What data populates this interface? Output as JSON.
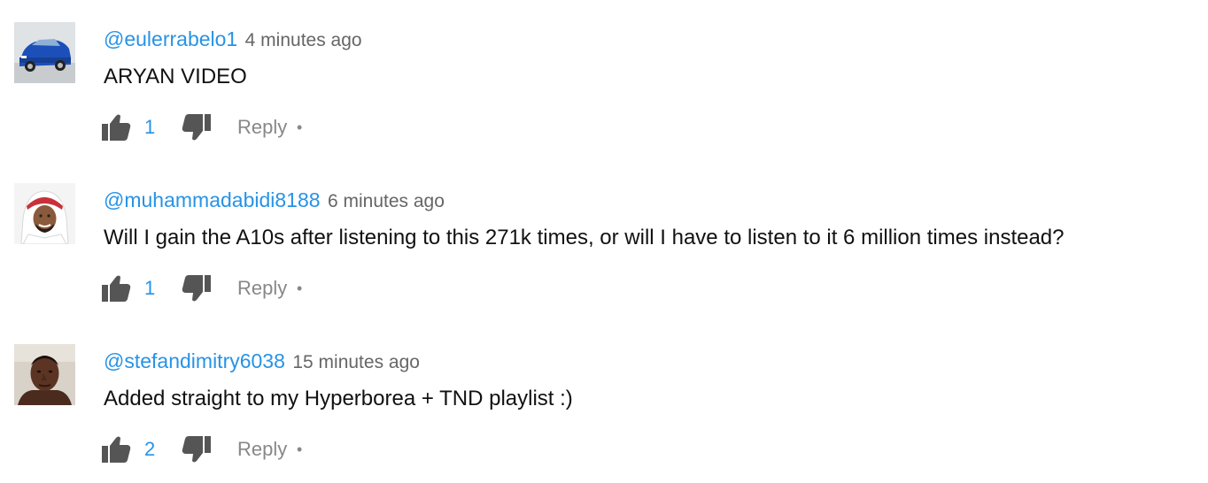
{
  "comments": [
    {
      "author": "@eulerrabelo1",
      "time": "4 minutes ago",
      "text": "ARYAN VIDEO",
      "likes": "1",
      "reply_label": "Reply",
      "separator": "•",
      "avatar": "blue-car-avatar"
    },
    {
      "author": "@muhammadabidi8188",
      "time": "6 minutes ago",
      "text": "Will I gain the A10s after listening to this 271k times, or will I have to listen to it 6 million times instead?",
      "likes": "1",
      "reply_label": "Reply",
      "separator": "•",
      "avatar": "man-keffiyeh-avatar"
    },
    {
      "author": "@stefandimitry6038",
      "time": "15 minutes ago",
      "text": "Added straight to my Hyperborea + TND playlist :)",
      "likes": "2",
      "reply_label": "Reply",
      "separator": "•",
      "avatar": "man-portrait-avatar"
    }
  ],
  "colors": {
    "author": "#2793e6",
    "like_count": "#2793e6",
    "secondary": "#888888",
    "icon": "#555555"
  },
  "icons": {
    "like": "thumbs-up-icon",
    "dislike": "thumbs-down-icon"
  }
}
